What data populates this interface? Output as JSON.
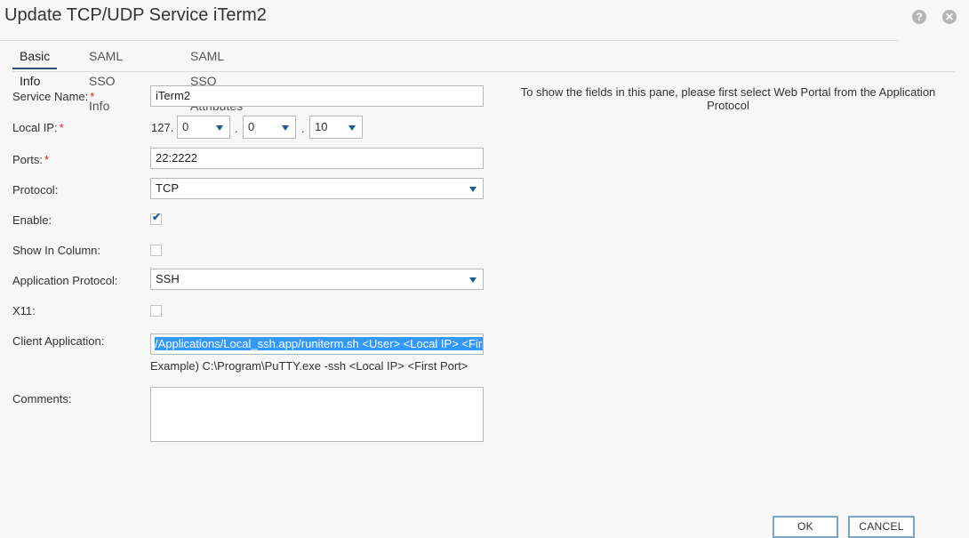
{
  "dialog": {
    "title": "Update TCP/UDP Service iTerm2",
    "help_icon": "?",
    "close_icon": "✕"
  },
  "tabs": [
    {
      "label": "Basic Info",
      "active": true
    },
    {
      "label": "SAML SSO Info",
      "active": false
    },
    {
      "label": "SAML SSO Attributes",
      "active": false
    }
  ],
  "form": {
    "service_name": {
      "label": "Service Name:",
      "value": "iTerm2",
      "required": "*"
    },
    "local_ip": {
      "label": "Local IP:",
      "required": "*",
      "prefix": "127.",
      "octet1": "0",
      "octet2": "0",
      "octet3": "10",
      "separator": "."
    },
    "ports": {
      "label": "Ports:",
      "value": "22:2222",
      "required": "*"
    },
    "protocol": {
      "label": "Protocol:",
      "value": "TCP"
    },
    "enable": {
      "label": "Enable:",
      "checked": true
    },
    "show_in_column": {
      "label": "Show In Column:",
      "checked": false
    },
    "application_protocol": {
      "label": "Application Protocol:",
      "value": "SSH"
    },
    "x11": {
      "label": "X11:",
      "checked": false
    },
    "client_application": {
      "label": "Client Application:",
      "value": "/Applications/Local_ssh.app/runiterm.sh <User> <Local IP> <First Port>",
      "hint": "Example) C:\\Program\\PuTTY.exe -ssh <Local IP> <First Port>"
    },
    "comments": {
      "label": "Comments:",
      "value": ""
    }
  },
  "pane_message": "To show the fields in this pane, please first select Web Portal from the Application Protocol",
  "buttons": {
    "ok": "OK",
    "cancel": "CANCEL"
  },
  "colors": {
    "accent": "#2b4f7d",
    "link_blue": "#1c5a9c",
    "required": "#d0202a",
    "selection": "#3399ff"
  }
}
